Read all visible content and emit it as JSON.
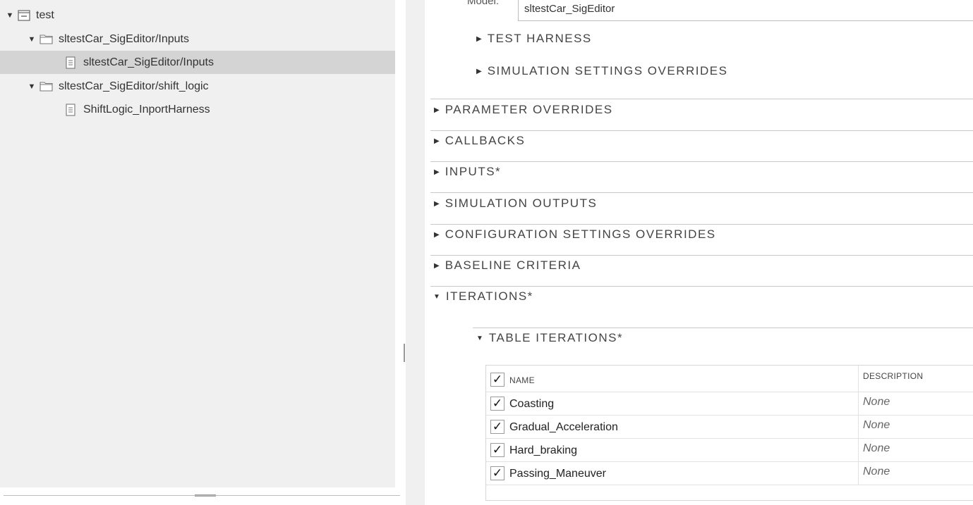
{
  "tree": {
    "items": [
      {
        "label": "test",
        "icon": "test-file-icon",
        "expanded": true
      },
      {
        "label": "sltestCar_SigEditor/Inputs",
        "icon": "folder-icon",
        "expanded": true
      },
      {
        "label": "sltestCar_SigEditor/Inputs",
        "icon": "document-icon",
        "selected": true
      },
      {
        "label": "sltestCar_SigEditor/shift_logic",
        "icon": "folder-icon",
        "expanded": true
      },
      {
        "label": "ShiftLogic_InportHarness",
        "icon": "document-icon"
      }
    ]
  },
  "model": {
    "label": "Model:",
    "value": "sltestCar_SigEditor"
  },
  "sections": {
    "test_harness": "TEST HARNESS",
    "sim_settings_overrides": "SIMULATION SETTINGS OVERRIDES",
    "parameter_overrides": "PARAMETER OVERRIDES",
    "callbacks": "CALLBACKS",
    "inputs": "INPUTS*",
    "simulation_outputs": "SIMULATION OUTPUTS",
    "config_settings_overrides": "CONFIGURATION SETTINGS OVERRIDES",
    "baseline_criteria": "BASELINE CRITERIA",
    "iterations": "ITERATIONS*",
    "table_iterations": "TABLE ITERATIONS*"
  },
  "iterations_table": {
    "header_name": "NAME",
    "header_description": "DESCRIPTION",
    "rows": [
      {
        "name": "Coasting",
        "description": "None",
        "checked": true
      },
      {
        "name": "Gradual_Acceleration",
        "description": "None",
        "checked": true
      },
      {
        "name": "Hard_braking",
        "description": "None",
        "checked": true
      },
      {
        "name": "Passing_Maneuver",
        "description": "None",
        "checked": true
      }
    ]
  },
  "glyphs": {
    "collapsed": "▶",
    "expanded": "▼",
    "check": "✓"
  },
  "colors": {
    "panel_bg": "#f0f0f0",
    "selected_row": "#d4d4d4",
    "text": "#333333"
  }
}
